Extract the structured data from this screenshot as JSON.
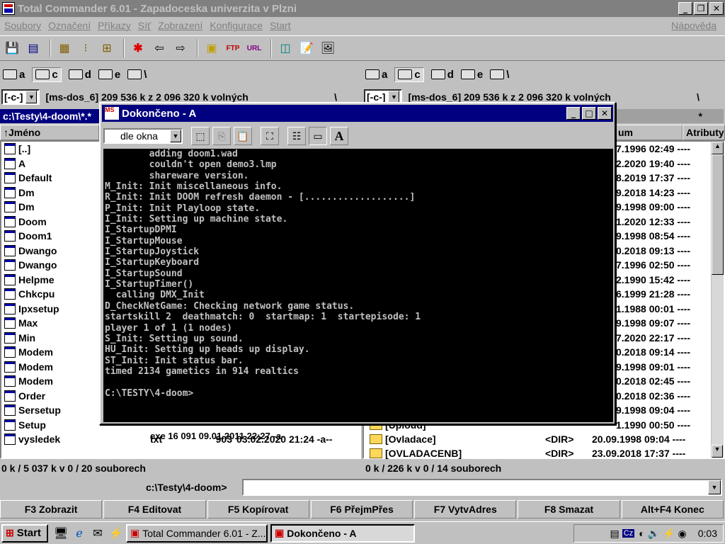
{
  "window": {
    "title": "Total Commander 6.01 - Zapadoceska univerzita v Plzni"
  },
  "menu": [
    "Soubory",
    "Označení",
    "Příkazy",
    "Síť",
    "Zobrazení",
    "Konfigurace",
    "Start"
  ],
  "menu_help": "Nápověda",
  "drives_left": [
    "a",
    "c",
    "d",
    "e",
    "\\"
  ],
  "drives_right": [
    "a",
    "c",
    "d",
    "e",
    "\\"
  ],
  "left": {
    "drive_combo": "[-c-]",
    "free_info": "[ms-dos_6]  209 536 k z 2 096 320 k volných",
    "root": "\\",
    "path": "c:\\Testy\\4-doom\\*.*",
    "header_name": "↑Jméno",
    "files": [
      {
        "name": "[..]",
        "icon": "up-dir-icon"
      },
      {
        "name": "A",
        "icon": "exe-icon"
      },
      {
        "name": "Default",
        "icon": "doc-icon"
      },
      {
        "name": "Dm",
        "icon": "image-icon"
      },
      {
        "name": "Dm",
        "icon": "exe-icon"
      },
      {
        "name": "Doom",
        "icon": "exe-icon"
      },
      {
        "name": "Doom1",
        "icon": "doc-icon"
      },
      {
        "name": "Dwango",
        "icon": "exe-icon"
      },
      {
        "name": "Dwango",
        "icon": "doc-icon"
      },
      {
        "name": "Helpme",
        "icon": "text-icon"
      },
      {
        "name": "Chkcpu",
        "icon": "exe-icon"
      },
      {
        "name": "Ipxsetup",
        "icon": "exe-icon"
      },
      {
        "name": "Max",
        "icon": "doc-icon"
      },
      {
        "name": "Min",
        "icon": "doc-icon"
      },
      {
        "name": "Modem",
        "icon": "doc-icon"
      },
      {
        "name": "Modem",
        "icon": "doc-icon"
      },
      {
        "name": "Modem",
        "icon": "doc-icon"
      },
      {
        "name": "Order",
        "icon": "doc-icon"
      },
      {
        "name": "Sersetup",
        "icon": "exe-icon"
      },
      {
        "name": "Setup",
        "icon": "exe-icon"
      },
      {
        "name": "vysledek",
        "icon": "text-icon"
      }
    ],
    "partial_row": "exe   16 091 09.01.2011 22:27 -a-",
    "last_row": {
      "ext": "txt",
      "size": "903",
      "date": "03.02.2020 21:24 -a--"
    },
    "status": "0 k / 5 037 k v 0 / 20 souborech"
  },
  "right": {
    "drive_combo": "[-c-]",
    "free_info": "[ms-dos_6]  209 536 k z 2 096 320 k volných",
    "root": "\\",
    "star": "*",
    "header_date": "um",
    "header_attr": "Atributy",
    "rows": [
      "7.1996 02:49 ----",
      "2.2020 19:40 ----",
      "8.2019 17:37 ----",
      "9.2018 14:23 ----",
      "9.1998 09:00 ----",
      "1.2020 12:33 ----",
      "9.1998 08:54 ----",
      "0.2018 09:13 ----",
      "7.1996 02:50 ----",
      "2.1990 15:42 ----",
      "6.1999 21:28 ----",
      "1.1988 00:01 ----",
      "9.1998 09:07 ----",
      "7.2020 22:17 ----",
      "0.2018 09:14 ----",
      "9.1998 09:01 ----",
      "0.2018 02:45 ----",
      "0.2018 02:36 ----",
      "9.1998 09:04 ----",
      "1.1990 00:50 ----"
    ],
    "partial_dir": "[Uploud]",
    "dirs": [
      {
        "name": "[Ovladace]",
        "size": "<DIR>",
        "date": "20.09.1998 09:04 ----"
      },
      {
        "name": "[OVLADACENB]",
        "size": "<DIR>",
        "date": "23.09.2018 17:37 ----"
      }
    ],
    "status": "0 k / 226 k v 0 / 14 souborech"
  },
  "cmd": {
    "path": "c:\\Testy\\4-doom>",
    "value": ""
  },
  "fkeys": [
    "F3 Zobrazit",
    "F4 Editovat",
    "F5 Kopírovat",
    "F6 PřejmPřes",
    "F7 VytvAdres",
    "F8 Smazat",
    "Alt+F4 Konec"
  ],
  "dialog": {
    "title": "Dokončeno - A",
    "icon_text": "MS",
    "font_select": "dle okna",
    "console_lines": [
      "        adding doom1.wad",
      "        couldn't open demo3.lmp",
      "        shareware version.",
      "M_Init: Init miscellaneous info.",
      "R_Init: Init DOOM refresh daemon - [...................]",
      "P_Init: Init Playloop state.",
      "I_Init: Setting up machine state.",
      "I_StartupDPMI",
      "I_StartupMouse",
      "I_StartupJoystick",
      "I_StartupKeyboard",
      "I_StartupSound",
      "I_StartupTimer()",
      "  calling DMX_Init",
      "D_CheckNetGame: Checking network game status.",
      "startskill 2  deathmatch: 0  startmap: 1  startepisode: 1",
      "player 1 of 1 (1 nodes)",
      "S_Init: Setting up sound.",
      "HU_Init: Setting up heads up display.",
      "ST_Init: Init status bar.",
      "timed 2134 gametics in 914 realtics",
      "",
      "C:\\TESTY\\4-doom>"
    ]
  },
  "taskbar": {
    "start": "Start",
    "tasks": [
      "Total Commander 6.01 - Z...",
      "Dokončeno - A"
    ],
    "tray_cz": "Cz",
    "clock": "0:03"
  }
}
